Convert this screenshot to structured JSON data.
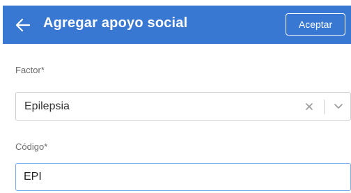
{
  "header": {
    "title": "Agregar apoyo social",
    "accept_label": "Aceptar",
    "back_icon": "arrow-left-icon",
    "color": "#3878d3"
  },
  "form": {
    "factor": {
      "label": "Factor*",
      "value": "Epilepsia",
      "clear_icon": "close-icon",
      "dropdown_icon": "chevron-down-icon"
    },
    "codigo": {
      "label": "Código*",
      "value": "EPI"
    }
  },
  "colors": {
    "input_focus_border": "#7aaaf0",
    "spellcheck_underline": "#e0393e"
  }
}
